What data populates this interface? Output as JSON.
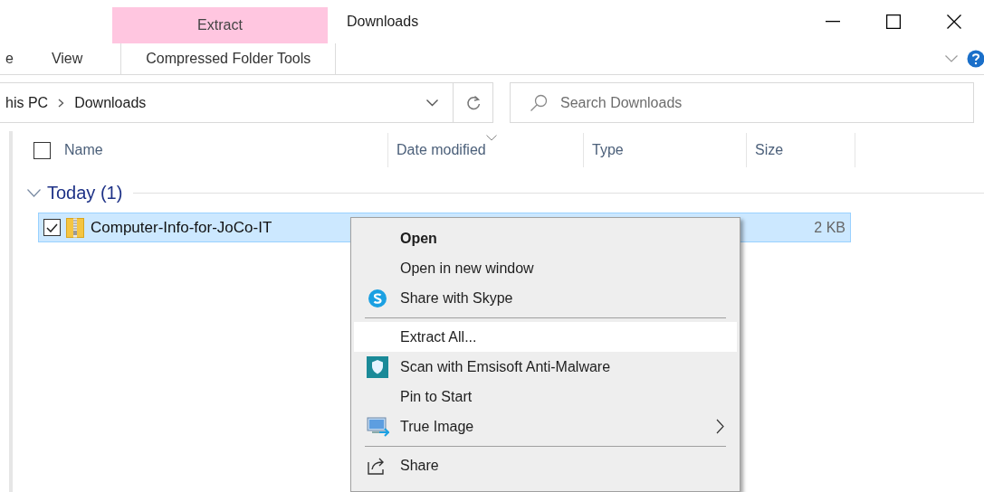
{
  "title_bar": {
    "context_tab": "Extract",
    "title": "Downloads"
  },
  "ribbon_tabs": [
    {
      "label": "e",
      "kind": "plain"
    },
    {
      "label": "View",
      "kind": "plain"
    },
    {
      "label": "Compressed Folder Tools",
      "kind": "contextual"
    }
  ],
  "address": {
    "crumbs": [
      "his PC",
      "Downloads"
    ]
  },
  "search": {
    "placeholder": "Search Downloads"
  },
  "select_all": {
    "checked": false
  },
  "columns": [
    {
      "label": "Name",
      "sorted": false
    },
    {
      "label": "Date modified",
      "sorted": true
    },
    {
      "label": "Type",
      "sorted": false
    },
    {
      "label": "Size",
      "sorted": false
    }
  ],
  "groups": [
    {
      "label": "Today (1)",
      "expanded": true,
      "files": [
        {
          "name": "Computer-Info-for-JoCo-IT",
          "size": "2 KB",
          "selected": true,
          "checked": true
        }
      ]
    }
  ],
  "context_menu": {
    "items": [
      {
        "kind": "item",
        "label": "Open",
        "default": true,
        "selected": false
      },
      {
        "kind": "item",
        "label": "Open in new window",
        "default": false,
        "selected": false
      },
      {
        "kind": "item",
        "label": "Share with Skype",
        "default": false,
        "selected": false
      },
      {
        "kind": "separator"
      },
      {
        "kind": "item",
        "label": "Extract All...",
        "default": false,
        "selected": true
      },
      {
        "kind": "item",
        "label": "Scan with Emsisoft Anti-Malware",
        "default": false,
        "selected": false
      },
      {
        "kind": "item",
        "label": "Pin to Start",
        "default": false,
        "selected": false
      },
      {
        "kind": "submenu",
        "label": "True Image",
        "default": false,
        "selected": false
      },
      {
        "kind": "separator"
      },
      {
        "kind": "item",
        "label": "Share",
        "default": false,
        "selected": false
      }
    ]
  }
}
